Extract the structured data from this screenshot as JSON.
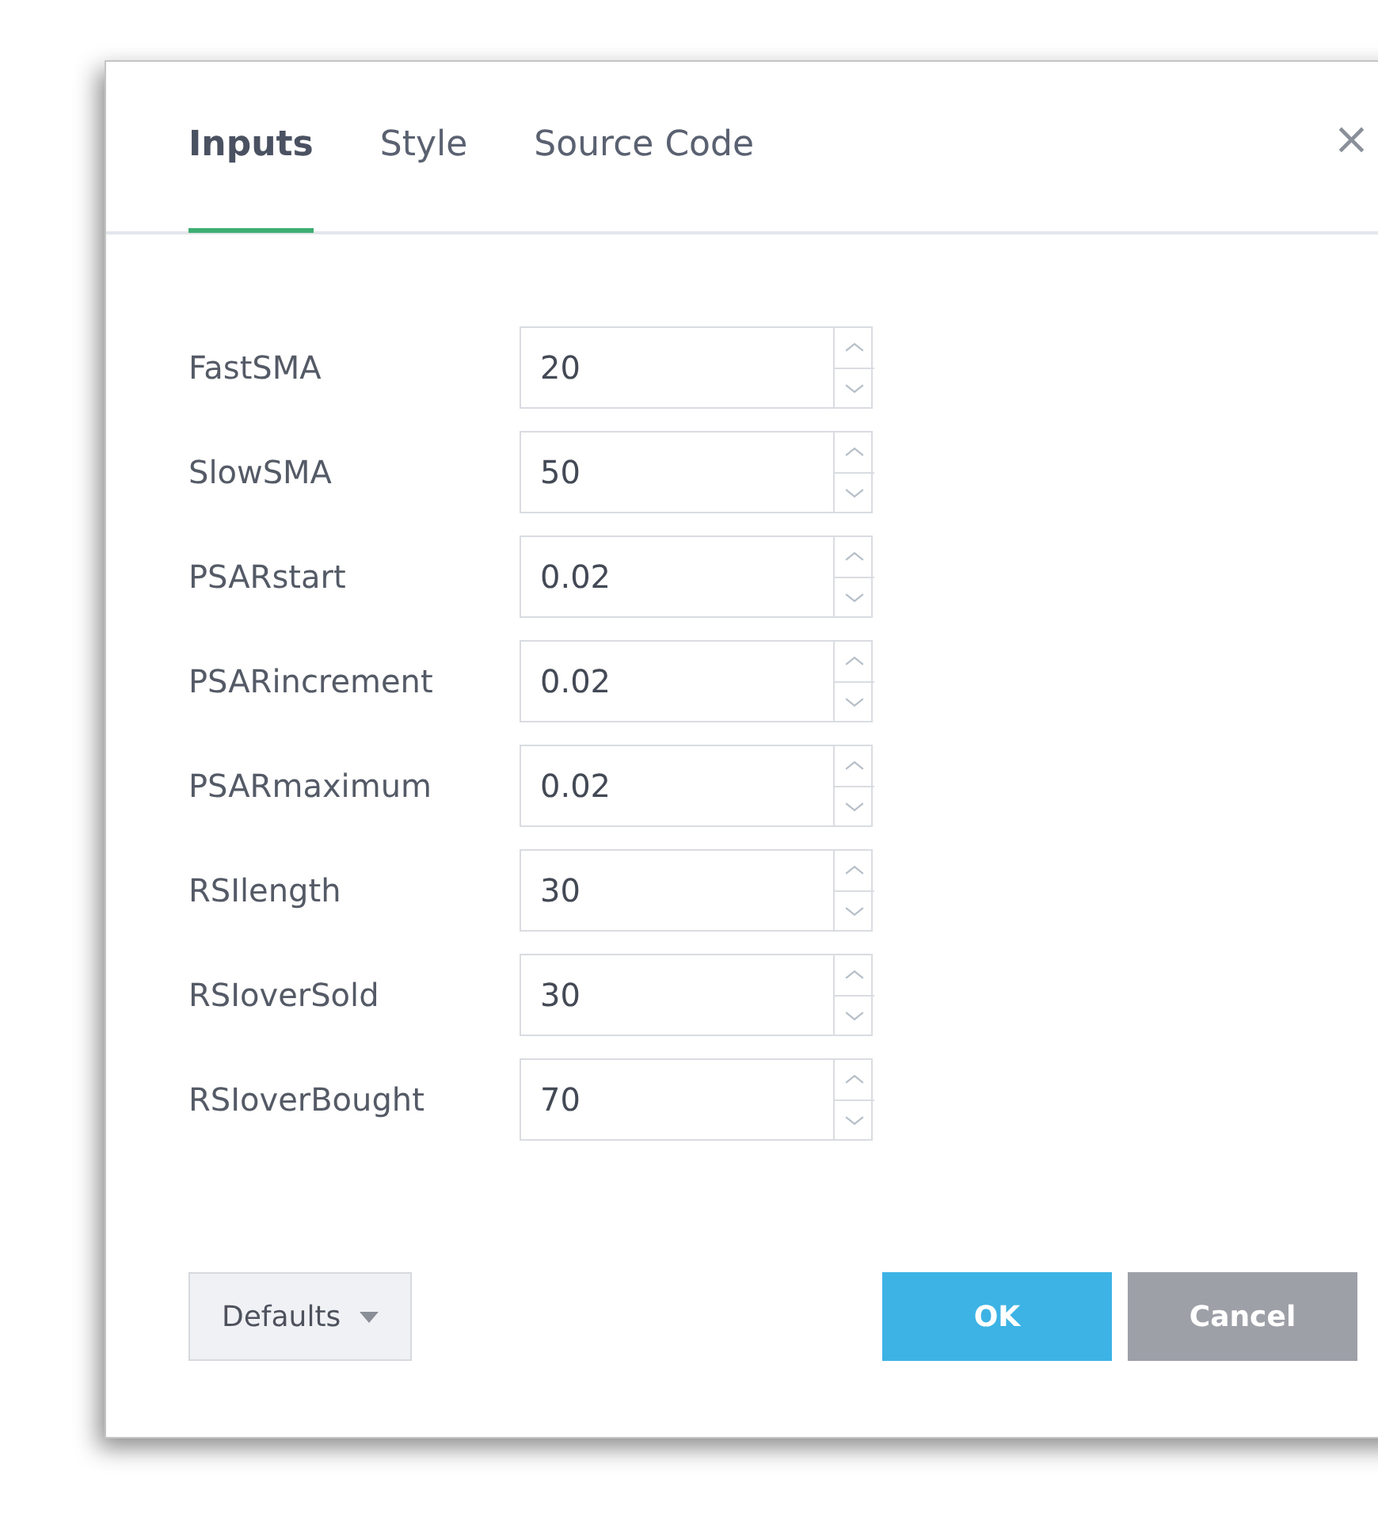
{
  "tabs": [
    {
      "label": "Inputs",
      "selected": true
    },
    {
      "label": "Style",
      "selected": false
    },
    {
      "label": "Source Code",
      "selected": false
    }
  ],
  "close": "×",
  "inputs": [
    {
      "label": "FastSMA",
      "value": "20"
    },
    {
      "label": "SlowSMA",
      "value": "50"
    },
    {
      "label": "PSARstart",
      "value": "0.02"
    },
    {
      "label": "PSARincrement",
      "value": "0.02"
    },
    {
      "label": "PSARmaximum",
      "value": "0.02"
    },
    {
      "label": "RSIlength",
      "value": "30"
    },
    {
      "label": "RSIoverSold",
      "value": "30"
    },
    {
      "label": "RSIoverBought",
      "value": "70"
    }
  ],
  "buttons": {
    "defaults": "Defaults",
    "ok": "OK",
    "cancel": "Cancel"
  }
}
